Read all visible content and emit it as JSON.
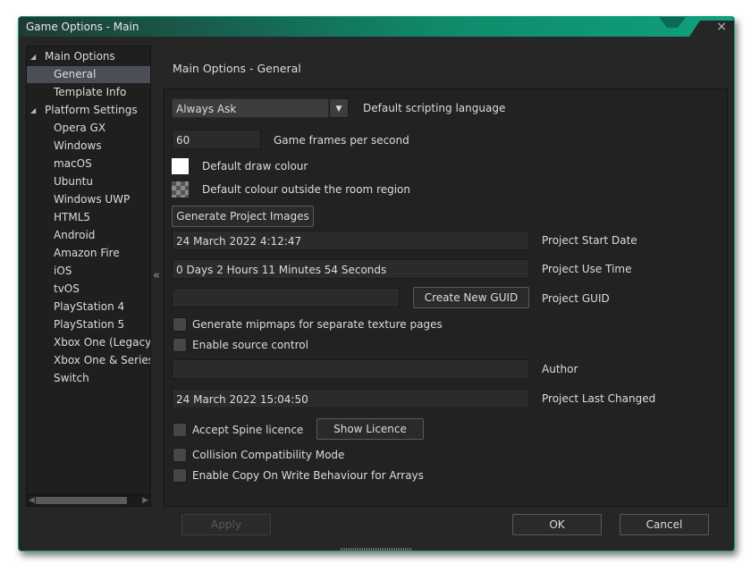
{
  "window": {
    "title": "Game Options - Main",
    "close_icon": "×",
    "accent": "#0fa07e"
  },
  "sidebar": {
    "items": [
      {
        "label": "Main Options",
        "level": 0,
        "expanded": true
      },
      {
        "label": "General",
        "level": 1,
        "selected": true
      },
      {
        "label": "Template Info",
        "level": 1
      },
      {
        "label": "Platform Settings",
        "level": 0,
        "expanded": true
      },
      {
        "label": "Opera GX",
        "level": 1
      },
      {
        "label": "Windows",
        "level": 1
      },
      {
        "label": "macOS",
        "level": 1
      },
      {
        "label": "Ubuntu",
        "level": 1
      },
      {
        "label": "Windows UWP",
        "level": 1
      },
      {
        "label": "HTML5",
        "level": 1
      },
      {
        "label": "Android",
        "level": 1
      },
      {
        "label": "Amazon Fire",
        "level": 1
      },
      {
        "label": "iOS",
        "level": 1
      },
      {
        "label": "tvOS",
        "level": 1
      },
      {
        "label": "PlayStation 4",
        "level": 1
      },
      {
        "label": "PlayStation 5",
        "level": 1
      },
      {
        "label": "Xbox One (Legacy/XDK)",
        "level": 1
      },
      {
        "label": "Xbox One & Series X|S",
        "level": 1
      },
      {
        "label": "Switch",
        "level": 1
      }
    ],
    "collapse_icon": "«"
  },
  "main": {
    "heading": "Main Options - General",
    "scripting": {
      "value": "Always Ask",
      "label": "Default scripting language"
    },
    "fps": {
      "value": "60",
      "label": "Game frames per second"
    },
    "draw_colour": {
      "label": "Default draw colour",
      "color": "#ffffff"
    },
    "outside_colour": {
      "label": "Default colour outside the room region"
    },
    "generate_images": "Generate Project Images",
    "start_date": {
      "value": "24 March 2022 4:12:47",
      "label": "Project Start Date"
    },
    "use_time": {
      "value": "0 Days 2 Hours 11 Minutes 54 Seconds",
      "label": "Project Use Time"
    },
    "guid": {
      "value": "",
      "button": "Create New GUID",
      "label": "Project GUID"
    },
    "mipmaps": {
      "label": "Generate mipmaps for separate texture pages",
      "checked": false
    },
    "source_control": {
      "label": "Enable source control",
      "checked": false
    },
    "author": {
      "value": "",
      "label": "Author"
    },
    "last_changed": {
      "value": "24 March 2022 15:04:50",
      "label": "Project Last Changed"
    },
    "spine": {
      "label": "Accept Spine licence",
      "checked": false,
      "button": "Show Licence"
    },
    "collision": {
      "label": "Collision Compatibility Mode",
      "checked": false
    },
    "copy_on_write": {
      "label": "Enable Copy On Write Behaviour for Arrays",
      "checked": false
    }
  },
  "footer": {
    "apply": "Apply",
    "ok": "OK",
    "cancel": "Cancel"
  }
}
